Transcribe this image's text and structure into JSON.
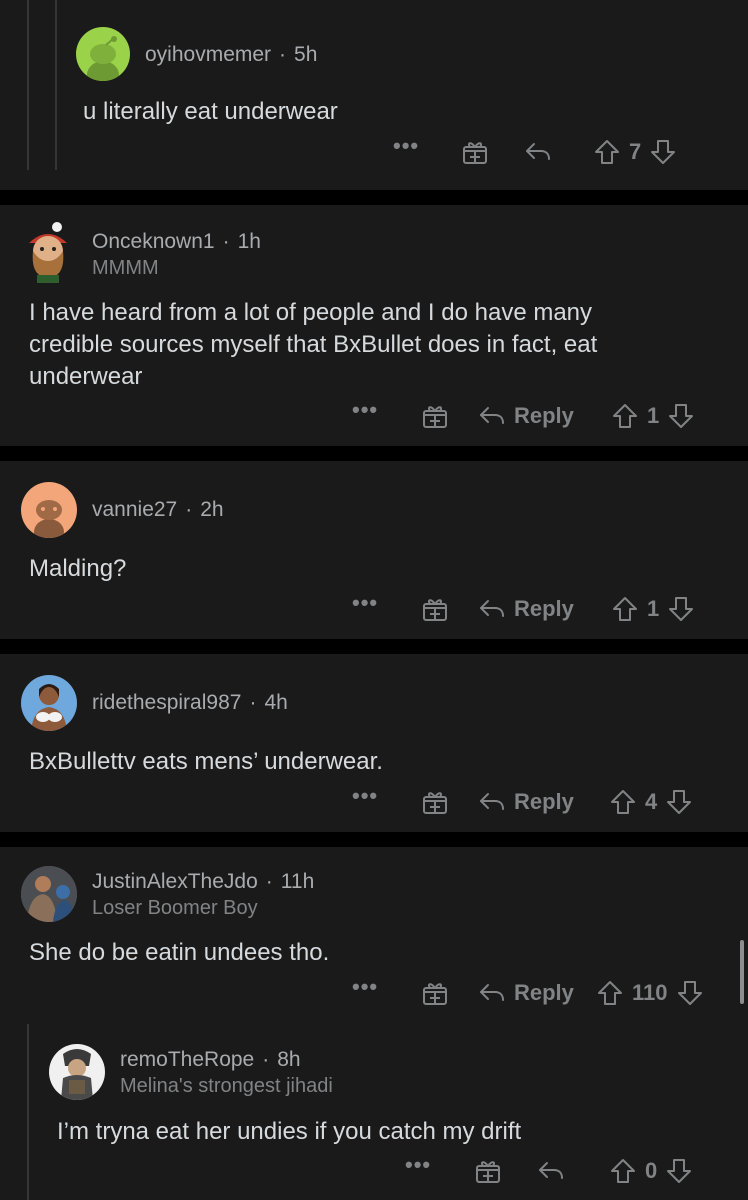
{
  "comments": [
    {
      "username": "oyihovmemer",
      "age": "5h",
      "flair": "",
      "body": [
        "u literally eat underwear"
      ],
      "has_reply_label": false,
      "reply_label": "",
      "score": "7",
      "avatar": {
        "type": "snoo",
        "color": "#9ad24a"
      }
    },
    {
      "username": "Onceknown1",
      "age": "1h",
      "flair": "MMMM",
      "body": [
        "I have heard from a lot of people and I do have many",
        "credible sources myself that BxBullet does in fact, eat",
        "underwear"
      ],
      "has_reply_label": true,
      "reply_label": "Reply",
      "score": "1",
      "avatar": {
        "type": "character",
        "color": "#c9a27c"
      }
    },
    {
      "username": "vannie27",
      "age": "2h",
      "flair": "",
      "body": [
        "Malding?"
      ],
      "has_reply_label": true,
      "reply_label": "Reply",
      "score": "1",
      "avatar": {
        "type": "snoo",
        "color": "#f2a679"
      }
    },
    {
      "username": "ridethespiral987",
      "age": "4h",
      "flair": "",
      "body": [
        "BxBullettv eats mens’ underwear."
      ],
      "has_reply_label": true,
      "reply_label": "Reply",
      "score": "4",
      "avatar": {
        "type": "photo",
        "color": "#6fa8dc"
      }
    },
    {
      "username": "JustinAlexTheJdo",
      "age": "11h",
      "flair": "Loser Boomer Boy",
      "body": [
        "She do be eatin undees tho."
      ],
      "has_reply_label": true,
      "reply_label": "Reply",
      "score": "110",
      "avatar": {
        "type": "photo",
        "color": "#8a6f5a"
      }
    },
    {
      "username": "remoTheRope",
      "age": "8h",
      "flair": "Melina's strongest jihadi",
      "body": [
        "I’m tryna eat her undies if you catch my drift"
      ],
      "has_reply_label": false,
      "reply_label": "",
      "score": "0",
      "avatar": {
        "type": "character",
        "color": "#e6e6e6"
      }
    }
  ],
  "more_label": "•••",
  "icons": [
    "more-options-icon",
    "award-gift-icon",
    "reply-arrow-icon",
    "upvote-arrow-icon",
    "downvote-arrow-icon"
  ],
  "colors": {
    "background": "#000000",
    "card": "#1a1a1b",
    "text": "#d7dadc",
    "muted": "#818384"
  }
}
